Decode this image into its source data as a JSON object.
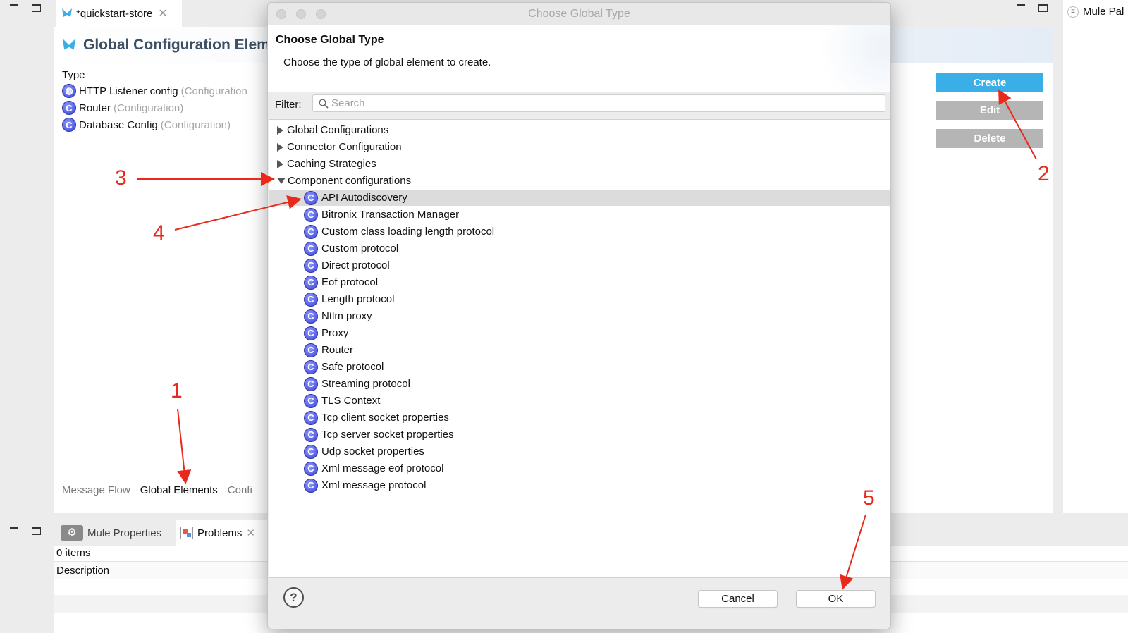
{
  "editor": {
    "tab_label": "*quickstart-store",
    "title": "Global Configuration Elem",
    "type_header": "Type",
    "elements": [
      {
        "name": "HTTP Listener config",
        "kind": "(Configuration"
      },
      {
        "name": "Router",
        "kind": "(Configuration)"
      },
      {
        "name": "Database Config",
        "kind": "(Configuration)"
      }
    ],
    "buttons": {
      "create": "Create",
      "edit": "Edit",
      "delete": "Delete"
    },
    "bottom_tabs": [
      "Message Flow",
      "Global Elements",
      "Confi"
    ]
  },
  "palette": {
    "label": "Mule Pal"
  },
  "bottom_panel": {
    "tabs": [
      "Mule Properties",
      "Problems"
    ],
    "count": "0 items",
    "column": "Description"
  },
  "dialog": {
    "window_title": "Choose Global Type",
    "heading": "Choose Global Type",
    "description": "Choose the type of global element to create.",
    "filter_label": "Filter:",
    "search_placeholder": "Search",
    "categories": [
      "Global Configurations",
      "Connector Configuration",
      "Caching Strategies",
      "Component configurations"
    ],
    "items": [
      "API Autodiscovery",
      "Bitronix Transaction Manager",
      "Custom class loading length protocol",
      "Custom protocol",
      "Direct protocol",
      "Eof protocol",
      "Length protocol",
      "Ntlm proxy",
      "Proxy",
      "Router",
      "Safe protocol",
      "Streaming protocol",
      "TLS Context",
      "Tcp client socket properties",
      "Tcp server socket properties",
      "Udp socket properties",
      "Xml message eof protocol",
      "Xml message protocol"
    ],
    "help": "?",
    "cancel": "Cancel",
    "ok": "OK"
  },
  "annotations": [
    "1",
    "2",
    "3",
    "4",
    "5"
  ],
  "colors": {
    "create_button": "#3aaee6",
    "disabled_button": "#b5b5b5",
    "annotation": "#e8291c",
    "icon_blue": "#4a52e6"
  }
}
